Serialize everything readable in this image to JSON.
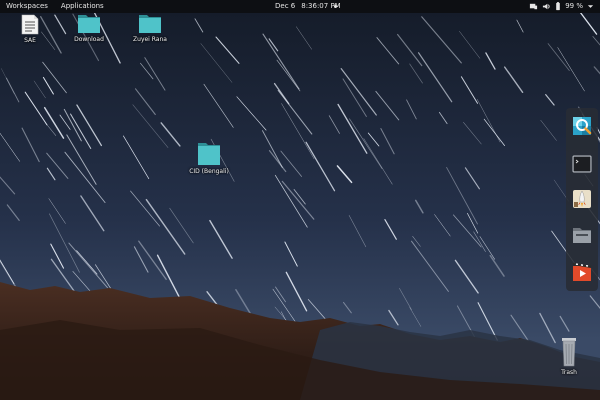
{
  "topbar": {
    "workspaces_label": "Workspaces",
    "applications_label": "Applications",
    "date": "Dec 6",
    "time": "8:36:07 PM",
    "battery": "99 %"
  },
  "desktop": {
    "icons": [
      {
        "label": "SAE",
        "type": "document"
      },
      {
        "label": "Download",
        "type": "folder"
      },
      {
        "label": "Zuyei Rana",
        "type": "folder"
      },
      {
        "label": "CID (Bengali)",
        "type": "folder"
      },
      {
        "label": "Trash",
        "type": "trash"
      }
    ]
  },
  "dock": {
    "items": [
      {
        "name": "image-viewer-icon"
      },
      {
        "name": "terminal-icon"
      },
      {
        "name": "rocket-launcher-icon"
      },
      {
        "name": "files-icon"
      },
      {
        "name": "video-player-icon"
      }
    ]
  },
  "colors": {
    "folder": "#4fc3c9",
    "folder_tab": "#2e8f96",
    "topbar": "#0d0f13",
    "dock": "#282c34"
  }
}
